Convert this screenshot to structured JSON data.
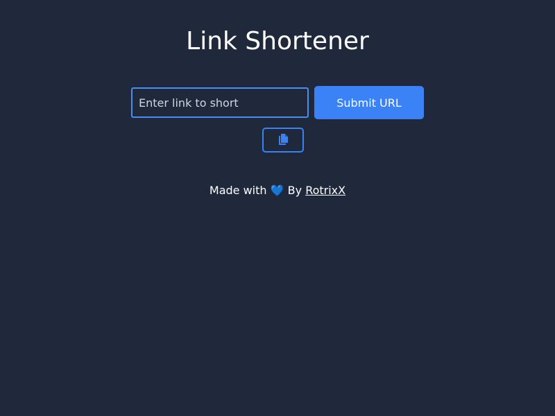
{
  "page": {
    "title": "Link Shortener"
  },
  "form": {
    "input_value": "",
    "input_placeholder": "Enter link to short",
    "submit_label": "Submit URL",
    "copy_icon": "copy-icon"
  },
  "footer": {
    "made_with": "Made with",
    "heart": "💙",
    "by": "By",
    "author_link": "RotrixX"
  },
  "colors": {
    "background": "#1f293b",
    "accent": "#3b82f6",
    "text": "#ffffff"
  }
}
